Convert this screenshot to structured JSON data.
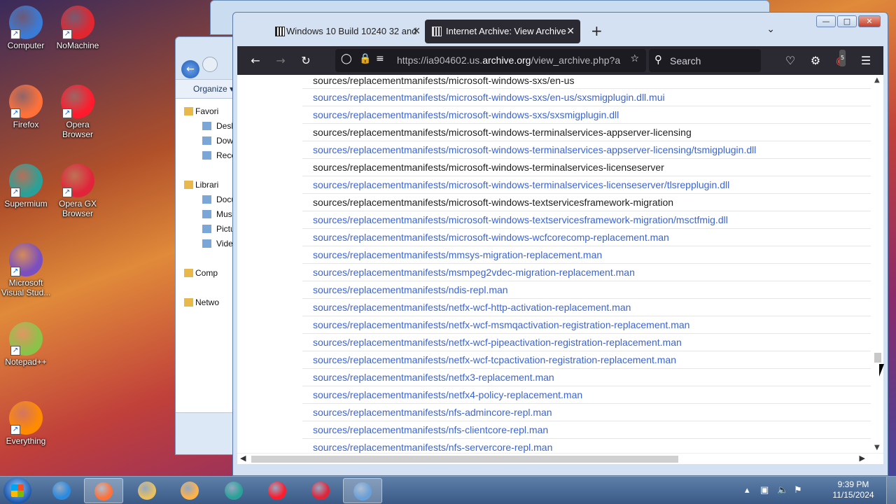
{
  "desktop": {
    "icons": [
      {
        "label": "Computer",
        "icon": "computer-icon",
        "color": "#3a7bd5"
      },
      {
        "label": "NoMachine",
        "icon": "nomachine-icon",
        "color": "#e0262f"
      },
      {
        "label": "Firefox",
        "icon": "firefox-icon",
        "color": "#ff7139"
      },
      {
        "label": "Opera Browser",
        "icon": "opera-icon",
        "color": "#ff1b2d"
      },
      {
        "label": "Supermium",
        "icon": "supermium-icon",
        "color": "#2aa198"
      },
      {
        "label": "Opera GX Browser",
        "icon": "opera-gx-icon",
        "color": "#e0243a"
      },
      {
        "label": "Microsoft Visual Stud...",
        "icon": "visual-studio-icon",
        "color": "#7a4fbf"
      },
      {
        "label": "Notepad++",
        "icon": "notepadpp-icon",
        "color": "#8bc34a"
      },
      {
        "label": "Everything",
        "icon": "everything-icon",
        "color": "#ff8c00"
      }
    ]
  },
  "explorer": {
    "organize": "Organize",
    "nav": [
      {
        "label": "Favori",
        "sub": false
      },
      {
        "label": "Deskt",
        "sub": true
      },
      {
        "label": "Dowr",
        "sub": true
      },
      {
        "label": "Rece",
        "sub": true
      },
      {
        "label": "",
        "sub": false
      },
      {
        "label": "Librari",
        "sub": false
      },
      {
        "label": "Docu",
        "sub": true
      },
      {
        "label": "Musi",
        "sub": true
      },
      {
        "label": "Pictu",
        "sub": true
      },
      {
        "label": "Vide",
        "sub": true
      },
      {
        "label": "",
        "sub": false
      },
      {
        "label": "Comp",
        "sub": false
      },
      {
        "label": "",
        "sub": false
      },
      {
        "label": "Netwo",
        "sub": false
      }
    ]
  },
  "firefox": {
    "tabs": [
      {
        "title": "Windows 10 Build 10240 32 and",
        "active": false
      },
      {
        "title": "Internet Archive: View Archive",
        "active": true
      }
    ],
    "url_prefix": "https://ia904602.us.",
    "url_domain": "archive.org",
    "url_suffix": "/view_archive.php?ar",
    "search_placeholder": "Search",
    "extension_badge": "5",
    "rows": [
      {
        "text": "sources/replacementmanifests/microsoft-windows-sxs/en-us",
        "link": false
      },
      {
        "text": "sources/replacementmanifests/microsoft-windows-sxs/en-us/sxsmigplugin.dll.mui",
        "link": true
      },
      {
        "text": "sources/replacementmanifests/microsoft-windows-sxs/sxsmigplugin.dll",
        "link": true
      },
      {
        "text": "sources/replacementmanifests/microsoft-windows-terminalservices-appserver-licensing",
        "link": false
      },
      {
        "text": "sources/replacementmanifests/microsoft-windows-terminalservices-appserver-licensing/tsmigplugin.dll",
        "link": true
      },
      {
        "text": "sources/replacementmanifests/microsoft-windows-terminalservices-licenseserver",
        "link": false
      },
      {
        "text": "sources/replacementmanifests/microsoft-windows-terminalservices-licenseserver/tlsrepplugin.dll",
        "link": true
      },
      {
        "text": "sources/replacementmanifests/microsoft-windows-textservicesframework-migration",
        "link": false
      },
      {
        "text": "sources/replacementmanifests/microsoft-windows-textservicesframework-migration/msctfmig.dll",
        "link": true
      },
      {
        "text": "sources/replacementmanifests/microsoft-windows-wcfcorecomp-replacement.man",
        "link": true
      },
      {
        "text": "sources/replacementmanifests/mmsys-migration-replacement.man",
        "link": true
      },
      {
        "text": "sources/replacementmanifests/msmpeg2vdec-migration-replacement.man",
        "link": true
      },
      {
        "text": "sources/replacementmanifests/ndis-repl.man",
        "link": true
      },
      {
        "text": "sources/replacementmanifests/netfx-wcf-http-activation-replacement.man",
        "link": true
      },
      {
        "text": "sources/replacementmanifests/netfx-wcf-msmqactivation-registration-replacement.man",
        "link": true
      },
      {
        "text": "sources/replacementmanifests/netfx-wcf-pipeactivation-registration-replacement.man",
        "link": true
      },
      {
        "text": "sources/replacementmanifests/netfx-wcf-tcpactivation-registration-replacement.man",
        "link": true
      },
      {
        "text": "sources/replacementmanifests/netfx3-replacement.man",
        "link": true
      },
      {
        "text": "sources/replacementmanifests/netfx4-policy-replacement.man",
        "link": true
      },
      {
        "text": "sources/replacementmanifests/nfs-admincore-repl.man",
        "link": true
      },
      {
        "text": "sources/replacementmanifests/nfs-clientcore-repl.man",
        "link": true
      },
      {
        "text": "sources/replacementmanifests/nfs-servercore-repl.man",
        "link": true
      }
    ]
  },
  "taskbar": {
    "apps": [
      {
        "name": "internet-explorer",
        "color": "#2a8ae0",
        "active": false
      },
      {
        "name": "firefox",
        "color": "#ff7139",
        "active": true
      },
      {
        "name": "file-explorer",
        "color": "#e8c060",
        "active": false
      },
      {
        "name": "media-player",
        "color": "#ffb24a",
        "active": false
      },
      {
        "name": "supermium",
        "color": "#2aa198",
        "active": false
      },
      {
        "name": "opera",
        "color": "#ff1b2d",
        "active": false
      },
      {
        "name": "opera-gx",
        "color": "#e0243a",
        "active": false
      },
      {
        "name": "control-panel",
        "color": "#6aa0d8",
        "active": true
      }
    ],
    "time": "9:39 PM",
    "date": "11/15/2024"
  }
}
